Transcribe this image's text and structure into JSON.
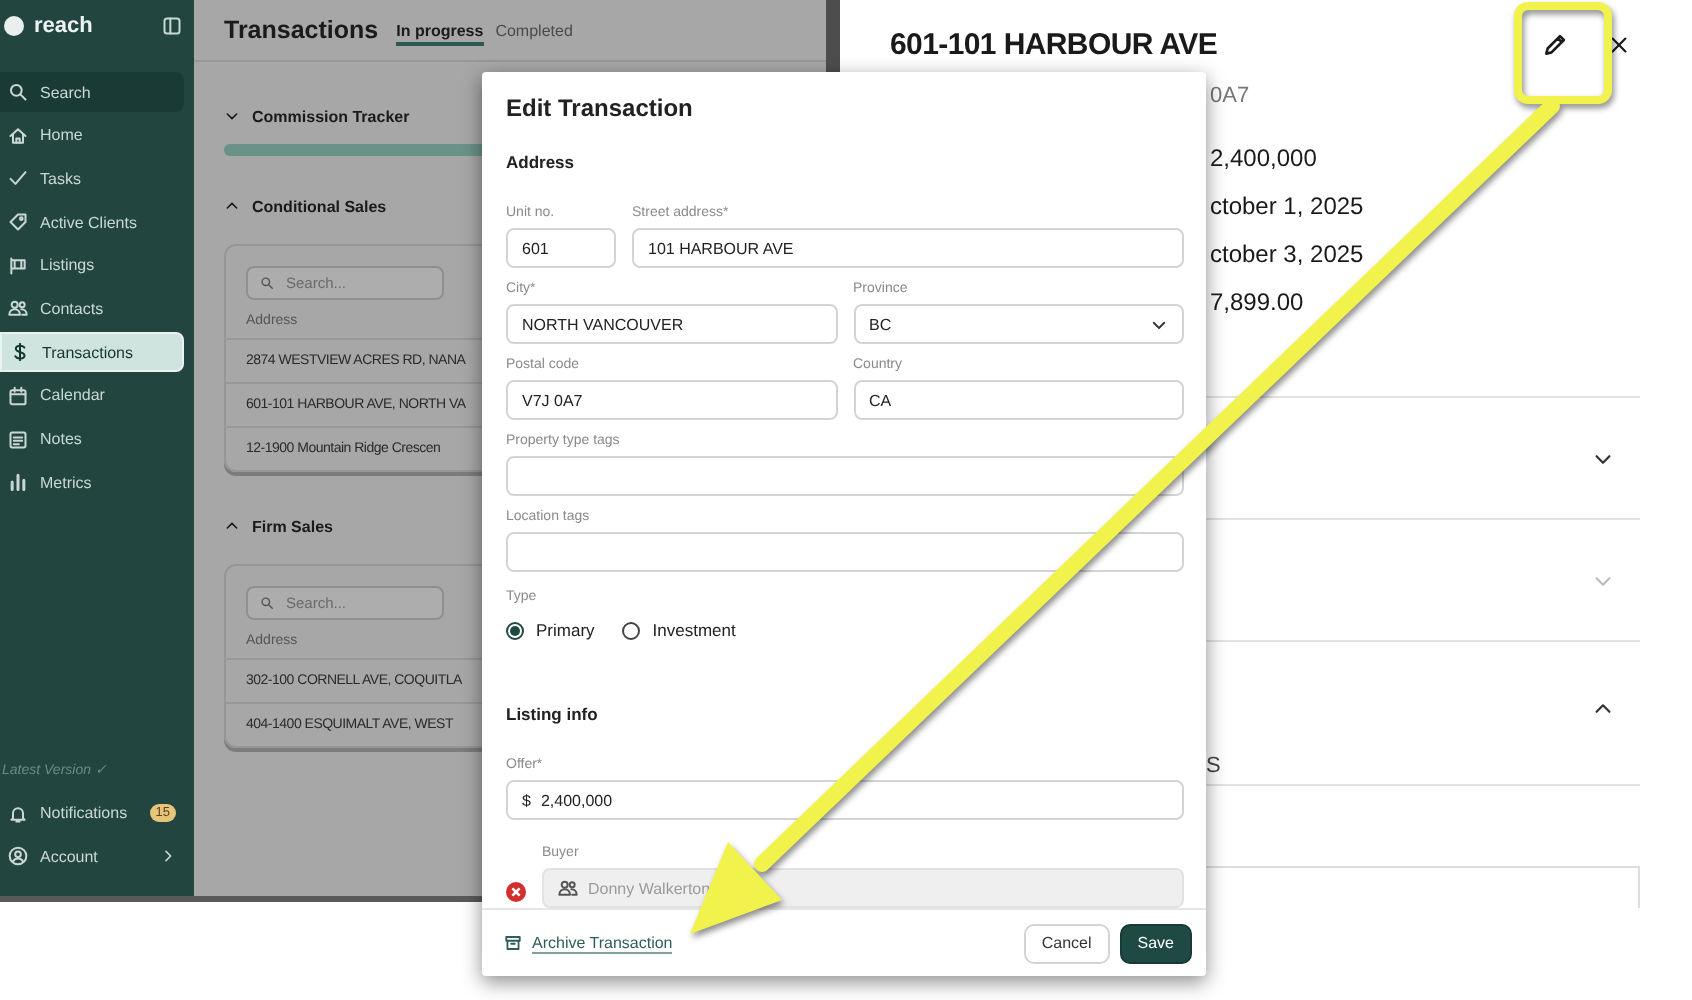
{
  "app": {
    "logo": "reach",
    "search_button": "Search",
    "nav": [
      {
        "label": "Home",
        "selected": false
      },
      {
        "label": "Tasks",
        "selected": false
      },
      {
        "label": "Active Clients",
        "selected": false
      },
      {
        "label": "Listings",
        "selected": false
      },
      {
        "label": "Contacts",
        "selected": false
      },
      {
        "label": "Transactions",
        "selected": true
      },
      {
        "label": "Calendar",
        "selected": false
      },
      {
        "label": "Notes",
        "selected": false
      },
      {
        "label": "Metrics",
        "selected": false
      }
    ],
    "version": "Latest Version ✓",
    "notifications": {
      "label": "Notifications",
      "count": "15"
    },
    "account": "Account",
    "page_title": "Transactions",
    "tabs": [
      {
        "label": "In progress",
        "selected": true
      },
      {
        "label": "Completed",
        "selected": false
      }
    ],
    "sections": [
      {
        "title": "Commission Tracker",
        "expanded": false,
        "kind": "tracker",
        "level": 1
      },
      {
        "title": "Conditional Sales",
        "expanded": true,
        "kind": "table",
        "search_placeholder": "Search...",
        "column": "Address",
        "rows": [
          "2874 WESTVIEW ACRES RD, NANA",
          "601-101 HARBOUR AVE, NORTH VA",
          "12-1900 Mountain Ridge Crescen"
        ]
      },
      {
        "title": "Firm Sales",
        "expanded": true,
        "kind": "table",
        "search_placeholder": "Search...",
        "column": "Address",
        "rows": [
          "302-100 CORNELL AVE, COQUITLA",
          "404-1400 ESQUIMALT AVE, WEST"
        ]
      }
    ]
  },
  "detail": {
    "title": "601-101 HARBOUR AVE",
    "subtitle": "0A7",
    "values": [
      "2,400,000",
      "ctober 1, 2025",
      "ctober 3, 2025",
      "7,899.00"
    ],
    "panels": [
      {
        "expanded": false,
        "disabled": false
      },
      {
        "expanded": false,
        "disabled": true
      },
      {
        "expanded": true,
        "disabled": false,
        "text": "S"
      }
    ]
  },
  "dialog": {
    "title": "Edit Transaction",
    "address_heading": "Address",
    "rows": [
      {
        "fields": [
          {
            "label": "Unit no.",
            "value": "601",
            "kind": "text"
          },
          {
            "label": "Street address*",
            "value": "101 HARBOUR AVE",
            "kind": "text"
          }
        ]
      },
      {
        "fields": [
          {
            "label": "City*",
            "value": "NORTH VANCOUVER",
            "kind": "text"
          },
          {
            "label": "Province",
            "value": "BC",
            "kind": "select"
          }
        ]
      },
      {
        "fields": [
          {
            "label": "Postal code",
            "value": "V7J 0A7",
            "kind": "text"
          },
          {
            "label": "Country",
            "value": "CA",
            "kind": "text"
          }
        ]
      },
      {
        "fields": [
          {
            "label": "Property type tags",
            "kind": "tags"
          }
        ]
      },
      {
        "fields": [
          {
            "label": "Location tags",
            "kind": "tags"
          }
        ]
      }
    ],
    "type": {
      "label": "Type",
      "options": [
        {
          "label": "Primary",
          "selected": true
        },
        {
          "label": "Investment",
          "selected": false
        }
      ]
    },
    "listing_heading": "Listing info",
    "offer": {
      "label": "Offer*",
      "prefix": "$",
      "value": "2,400,000"
    },
    "buyer": {
      "label": "Buyer",
      "value": "Donny Walkerton",
      "disabled": true
    },
    "archive_link": "Archive Transaction",
    "buttons": [
      {
        "label": "Cancel",
        "kind": "secondary"
      },
      {
        "label": "Save",
        "kind": "primary"
      }
    ]
  }
}
